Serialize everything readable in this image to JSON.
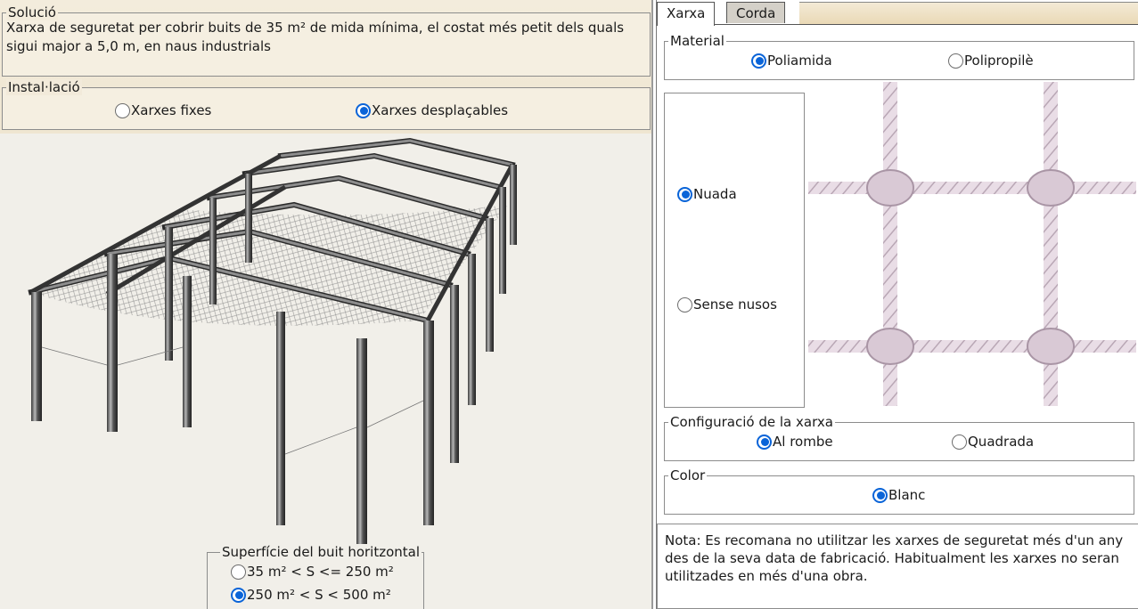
{
  "left": {
    "solucio": {
      "legend": "Solució",
      "text": "Xarxa de seguretat per cobrir buits de 35 m² de mida mínima, el costat més petit dels quals sigui major a 5,0 m, en naus industrials"
    },
    "installacio": {
      "legend": "Instal·lació",
      "options": [
        {
          "label": "Xarxes fixes",
          "selected": false
        },
        {
          "label": "Xarxes desplaçables",
          "selected": true
        }
      ]
    },
    "superficie": {
      "legend": "Superfície del buit horitzontal",
      "options": [
        {
          "label": "35 m² < S <= 250 m²",
          "selected": false
        },
        {
          "label": "250 m² < S < 500 m²",
          "selected": true
        }
      ]
    }
  },
  "right": {
    "tabs": [
      {
        "label": "Xarxa",
        "active": true
      },
      {
        "label": "Corda",
        "active": false
      }
    ],
    "material": {
      "legend": "Material",
      "options": [
        {
          "label": "Poliamida",
          "selected": true
        },
        {
          "label": "Polipropilè",
          "selected": false
        }
      ]
    },
    "knot": {
      "options": [
        {
          "label": "Nuada",
          "selected": true
        },
        {
          "label": "Sense nusos",
          "selected": false
        }
      ]
    },
    "configuracio": {
      "legend": "Configuració de la xarxa",
      "options": [
        {
          "label": "Al rombe",
          "selected": true
        },
        {
          "label": "Quadrada",
          "selected": false
        }
      ]
    },
    "color": {
      "legend": "Color",
      "options": [
        {
          "label": "Blanc",
          "selected": true
        }
      ]
    },
    "nota": "Nota: Es recomana no utilitzar les xarxes de seguretat més d'un any des de la seva data de fabricació. Habitualment les xarxes no seran utilitzades en més d'una obra."
  },
  "colors": {
    "radio_accent": "#0a64d8",
    "left_background": "#f1efe9",
    "header_background": "#f3ecdc",
    "tab_inactive": "#d4d0c8"
  }
}
